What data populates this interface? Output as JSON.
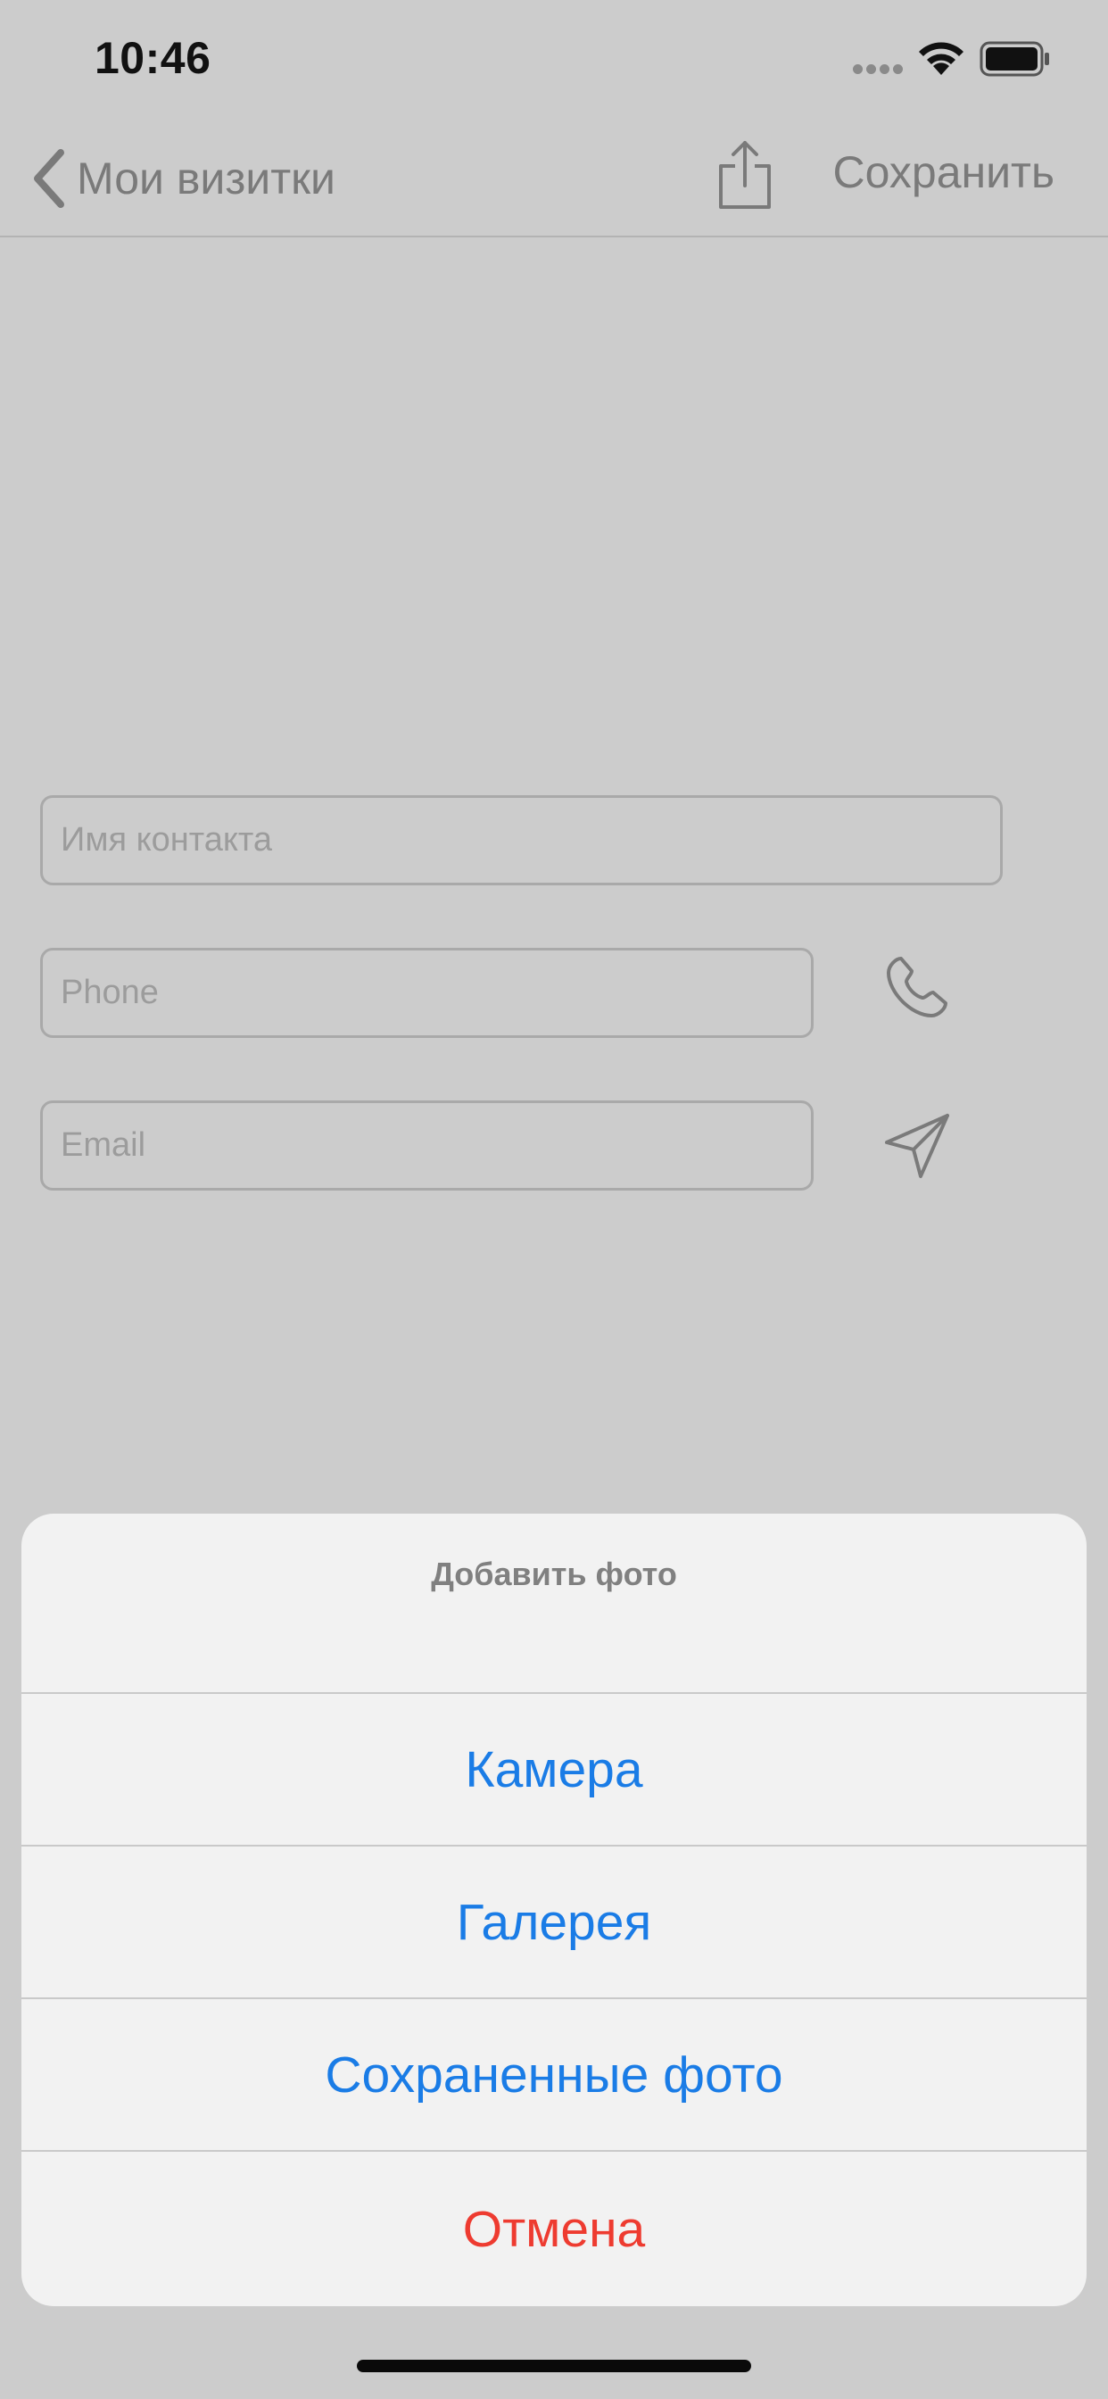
{
  "status_bar": {
    "time": "10:46"
  },
  "nav": {
    "back_label": "Мои визитки",
    "save_label": "Сохранить"
  },
  "form": {
    "name_placeholder": "Имя контакта",
    "phone_placeholder": "Phone",
    "email_placeholder": "Email"
  },
  "action_sheet": {
    "title": "Добавить фото",
    "options": [
      {
        "label": "Камера"
      },
      {
        "label": "Галерея"
      },
      {
        "label": "Сохраненные фото"
      }
    ],
    "cancel_label": "Отмена"
  },
  "colors": {
    "background": "#cccccc",
    "sheet_background": "#f2f2f2",
    "action_blue": "#1a7ce6",
    "destructive_red": "#ee3b30"
  },
  "icons": {
    "back": "chevron-left-icon",
    "share": "share-icon",
    "phone": "phone-icon",
    "send": "paper-plane-icon",
    "wifi": "wifi-icon",
    "battery": "battery-icon"
  }
}
